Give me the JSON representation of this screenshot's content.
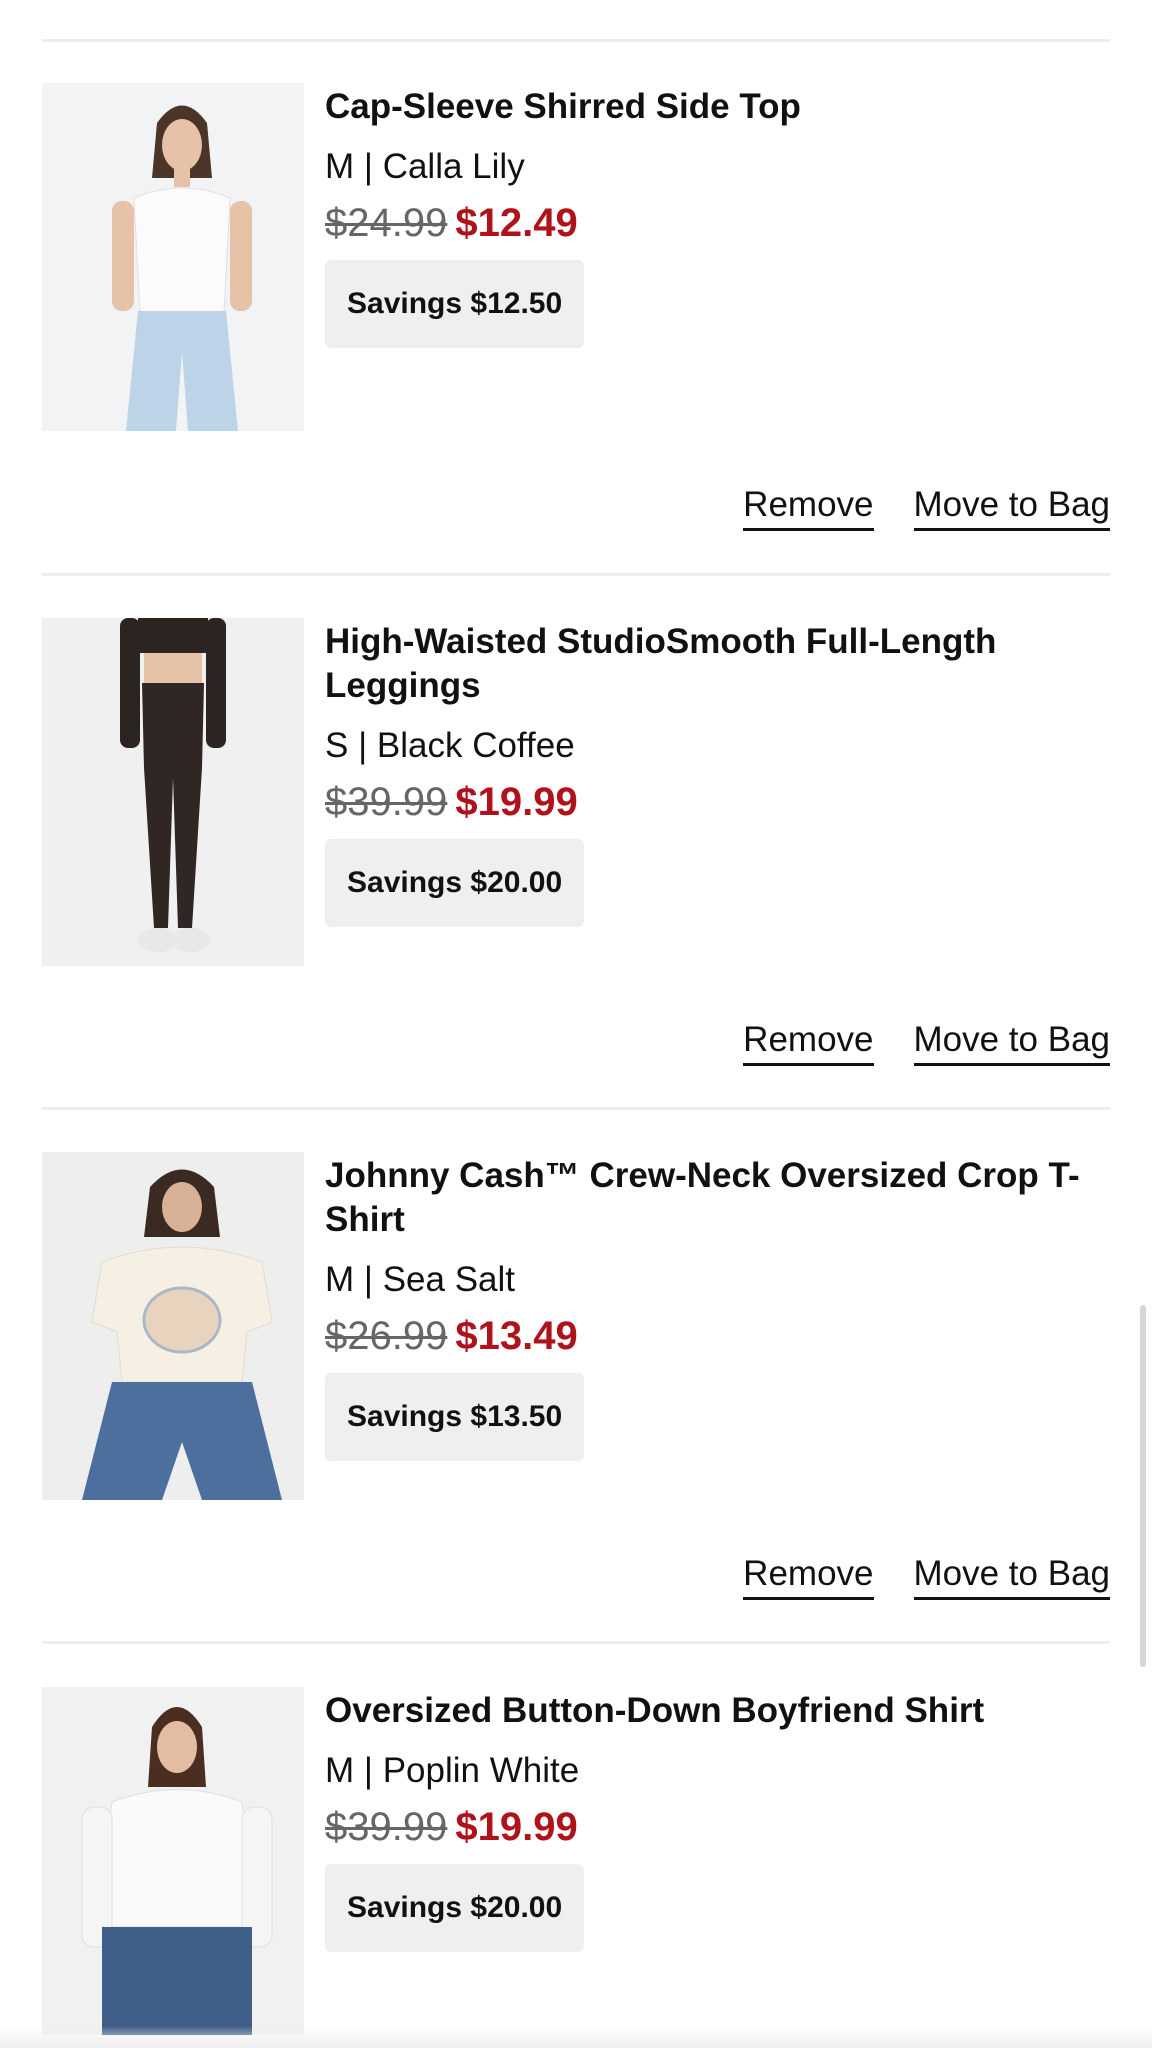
{
  "wishlist": {
    "items": [
      {
        "title": "Cap-Sleeve Shirred Side Top",
        "variant": "M | Calla Lily",
        "original_price": "$24.99",
        "sale_price": "$12.49",
        "savings": "Savings $12.50",
        "remove_label": "Remove",
        "move_label": "Move to Bag",
        "image_alt": "Model in white cap-sleeve top and light jeans"
      },
      {
        "title": "High-Waisted StudioSmooth Full-Length Leggings",
        "variant": "S | Black Coffee",
        "original_price": "$39.99",
        "sale_price": "$19.99",
        "savings": "Savings $20.00",
        "remove_label": "Remove",
        "move_label": "Move to Bag",
        "image_alt": "Model in dark brown leggings and white sneakers"
      },
      {
        "title": "Johnny Cash™ Crew-Neck Oversized Crop T-Shirt",
        "variant": "M | Sea Salt",
        "original_price": "$26.99",
        "sale_price": "$13.49",
        "savings": "Savings $13.50",
        "remove_label": "Remove",
        "move_label": "Move to Bag",
        "image_alt": "Model in cream graphic crop tee and blue jeans"
      },
      {
        "title": "Oversized Button-Down Boyfriend Shirt",
        "variant": "M | Poplin White",
        "original_price": "$39.99",
        "sale_price": "$19.99",
        "savings": "Savings $20.00",
        "image_alt": "Model in white button-down shirt and jeans"
      }
    ]
  },
  "colors": {
    "sale_price": "#b0121b",
    "savings_bg": "#efeff1",
    "divider": "#eeeeee"
  }
}
